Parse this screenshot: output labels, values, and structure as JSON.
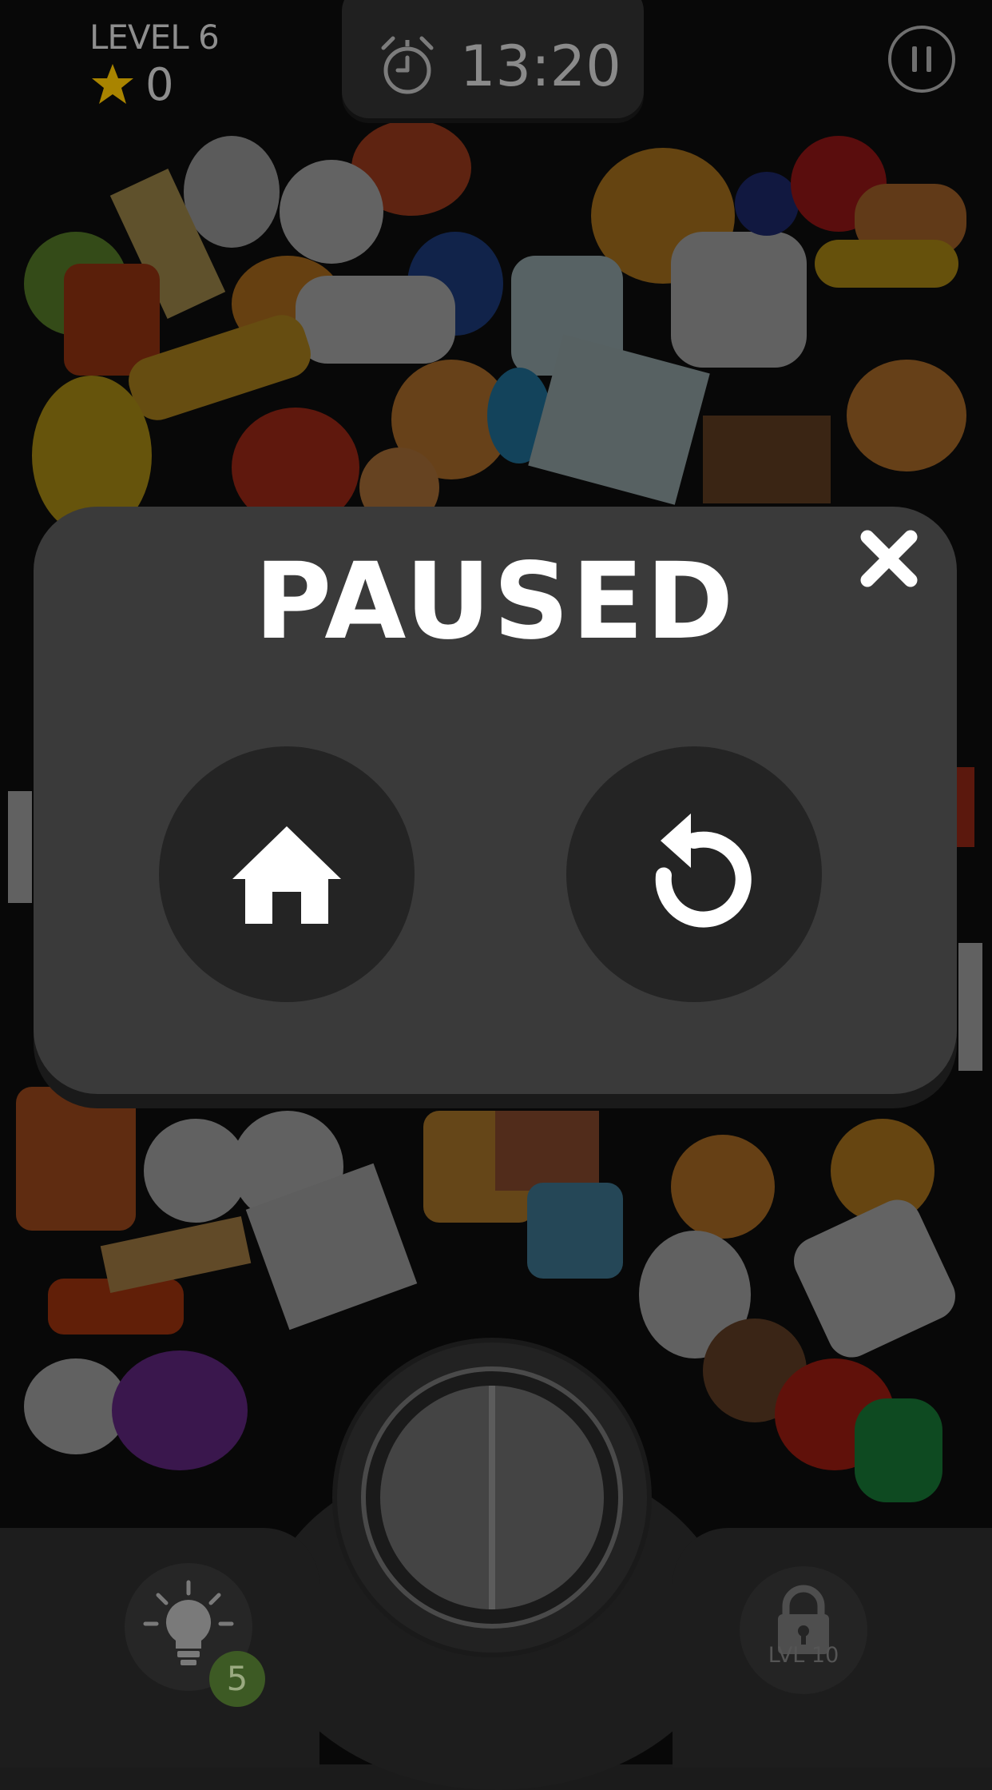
{
  "hud": {
    "level_label": "LEVEL 6",
    "score": "0",
    "timer": "13:20",
    "star_icon": "star-icon",
    "timer_icon": "alarm-clock-icon",
    "pause_icon": "pause-icon"
  },
  "pause_modal": {
    "title": "PAUSED",
    "close_icon": "close-icon",
    "home_icon": "home-icon",
    "restart_icon": "restart-icon"
  },
  "bottom_bar": {
    "hint_icon": "lightbulb-icon",
    "hint_count": "5",
    "lock_icon": "lock-icon",
    "lock_label": "LVL 10"
  },
  "colors": {
    "modal_bg": "#3a3a3a",
    "button_bg": "#242424",
    "star": "#d9a600",
    "hint_badge": "#3d5a24"
  }
}
